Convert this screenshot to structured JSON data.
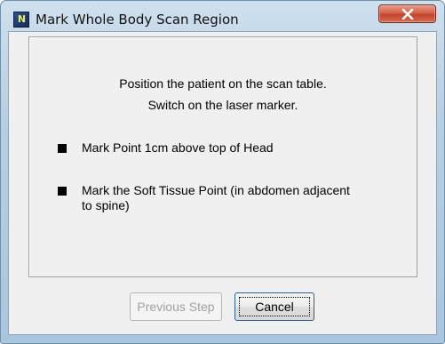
{
  "window": {
    "title": "Mark Whole Body Scan Region",
    "icon": "app-icon",
    "close_icon": "close-icon"
  },
  "instructions": {
    "line1": "Position the patient on the scan table.",
    "line2": "Switch on the laser marker."
  },
  "steps": [
    {
      "text": "Mark Point 1cm above top of Head"
    },
    {
      "line1": "Mark the Soft Tissue Point (in abdomen adjacent",
      "line2": "to spine)"
    }
  ],
  "buttons": {
    "previous": "Previous Step",
    "cancel": "Cancel"
  }
}
